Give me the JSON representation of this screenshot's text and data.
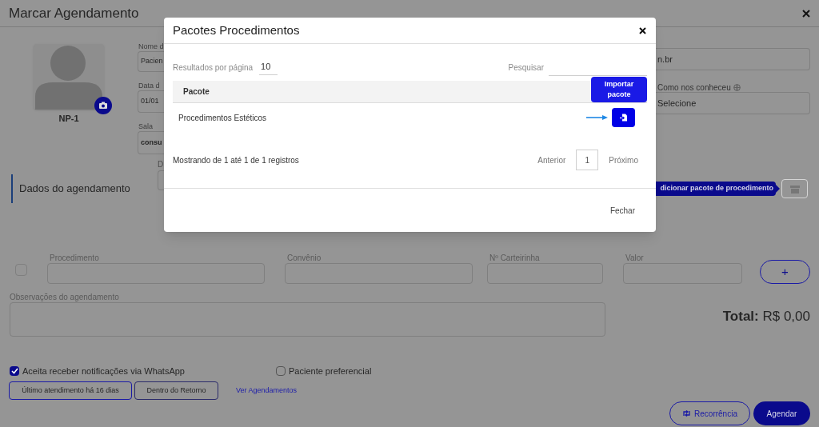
{
  "window": {
    "title": "Marcar Agendamento"
  },
  "patient": {
    "code": "NP-1"
  },
  "fields": [
    {
      "label": "Nome d",
      "value": "Pacien"
    },
    {
      "label": "Data d",
      "value": "01/01"
    },
    {
      "label": "Sala",
      "value": "consu"
    }
  ],
  "right_fields": [
    {
      "value": "n.br"
    },
    {
      "label": "Como nos conheceu",
      "value": "Selecione"
    }
  ],
  "section": {
    "title": "Dados do agendamento",
    "field_label": "D"
  },
  "package_tooltip": "dicionar pacote de procedimento",
  "procedure_row": {
    "checked": false,
    "fields": [
      {
        "label": "Procedimento"
      },
      {
        "label": "Convênio"
      },
      {
        "label": "Nº Carteirinha"
      },
      {
        "label": "Valor"
      }
    ],
    "add": "+"
  },
  "notes": {
    "label": "Observações do agendamento"
  },
  "total": "**Total:** R$ 0,00",
  "options": [
    {
      "label": "Aceita receber notificações via WhatsApp",
      "checked": true
    },
    {
      "label": "Paciente preferencial",
      "checked": false
    }
  ],
  "badges": [
    "Último atendimento há 16 dias",
    "Dentro do Retorno"
  ],
  "link": "Ver Agendamentos",
  "actions": [
    {
      "label": "Recorrência",
      "kind": "outline"
    },
    {
      "label": "Agendar",
      "kind": "primary"
    }
  ],
  "modal": {
    "title": "Pacotes Procedimentos",
    "per_page_label": "Resultados por página",
    "per_page": "10",
    "search_label": "Pesquisar",
    "column": "Pacote",
    "rows": [
      {
        "name": "Procedimentos Estéticos"
      }
    ],
    "tooltip": "Importar pacote",
    "info": "Mostrando de 1 até 1 de 1 registros",
    "prev": "Anterior",
    "page": "1",
    "next": "Próximo",
    "close_button": "Fechar"
  }
}
